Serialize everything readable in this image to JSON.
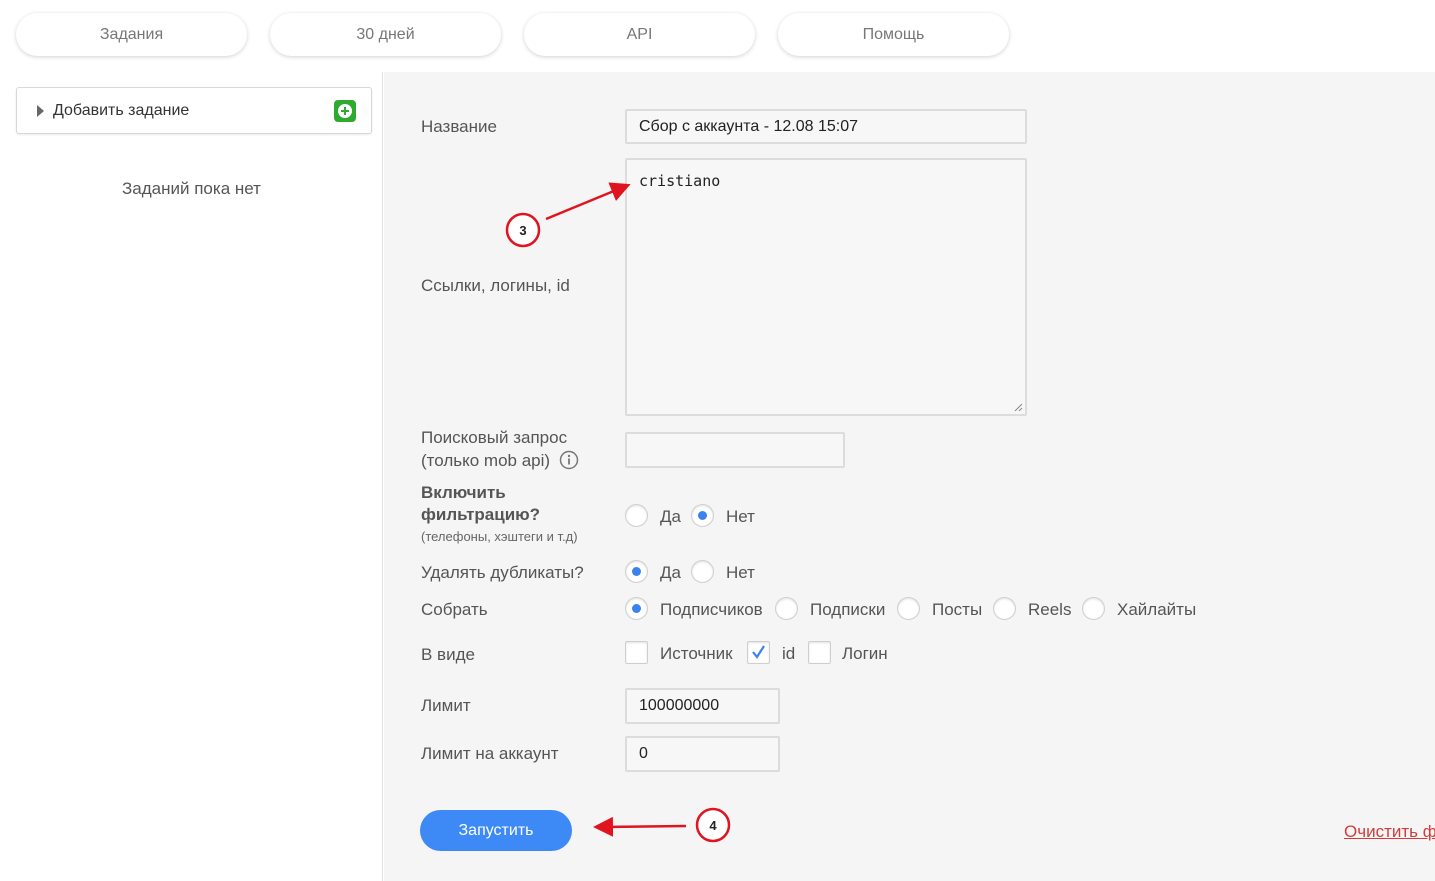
{
  "tabs": [
    {
      "label": "Задания"
    },
    {
      "label": "30 дней"
    },
    {
      "label": "API"
    },
    {
      "label": "Помощь"
    }
  ],
  "sidebar": {
    "add_task_label": "Добавить задание",
    "empty_text": "Заданий пока нет"
  },
  "form": {
    "name_label": "Название",
    "name_value": "Сбор с аккаунта - 12.08 15:07",
    "links_label": "Ссылки, логины, id",
    "links_value": "cristiano",
    "search_label_line1": "Поисковый запрос",
    "search_label_line2": "(только mob api)",
    "search_value": "",
    "filter_label_line1": "Включить",
    "filter_label_line2": "фильтрацию?",
    "filter_hint": "(телефоны, хэштеги и т.д)",
    "filter_options": [
      {
        "label": "Да",
        "selected": false
      },
      {
        "label": "Нет",
        "selected": true
      }
    ],
    "dedupe_label": "Удалять дубликаты?",
    "dedupe_options": [
      {
        "label": "Да",
        "selected": true
      },
      {
        "label": "Нет",
        "selected": false
      }
    ],
    "collect_label": "Собрать",
    "collect_options": [
      {
        "label": "Подписчиков",
        "selected": true
      },
      {
        "label": "Подписки",
        "selected": false
      },
      {
        "label": "Посты",
        "selected": false
      },
      {
        "label": "Reels",
        "selected": false
      },
      {
        "label": "Хайлайты",
        "selected": false
      }
    ],
    "format_label": "В виде",
    "format_options": [
      {
        "label": "Источник",
        "checked": false
      },
      {
        "label": "id",
        "checked": true
      },
      {
        "label": "Логин",
        "checked": false
      }
    ],
    "limit_label": "Лимит",
    "limit_value": "100000000",
    "account_limit_label": "Лимит на аккаунт",
    "account_limit_value": "0",
    "run_label": "Запустить",
    "clear_label": "Очистить ф"
  },
  "annotations": [
    {
      "number": "3"
    },
    {
      "number": "4"
    }
  ],
  "colors": {
    "accent": "#3d8af7",
    "annotation": "#e0141e",
    "success": "#2eaa2e",
    "link": "#d23c3c"
  }
}
